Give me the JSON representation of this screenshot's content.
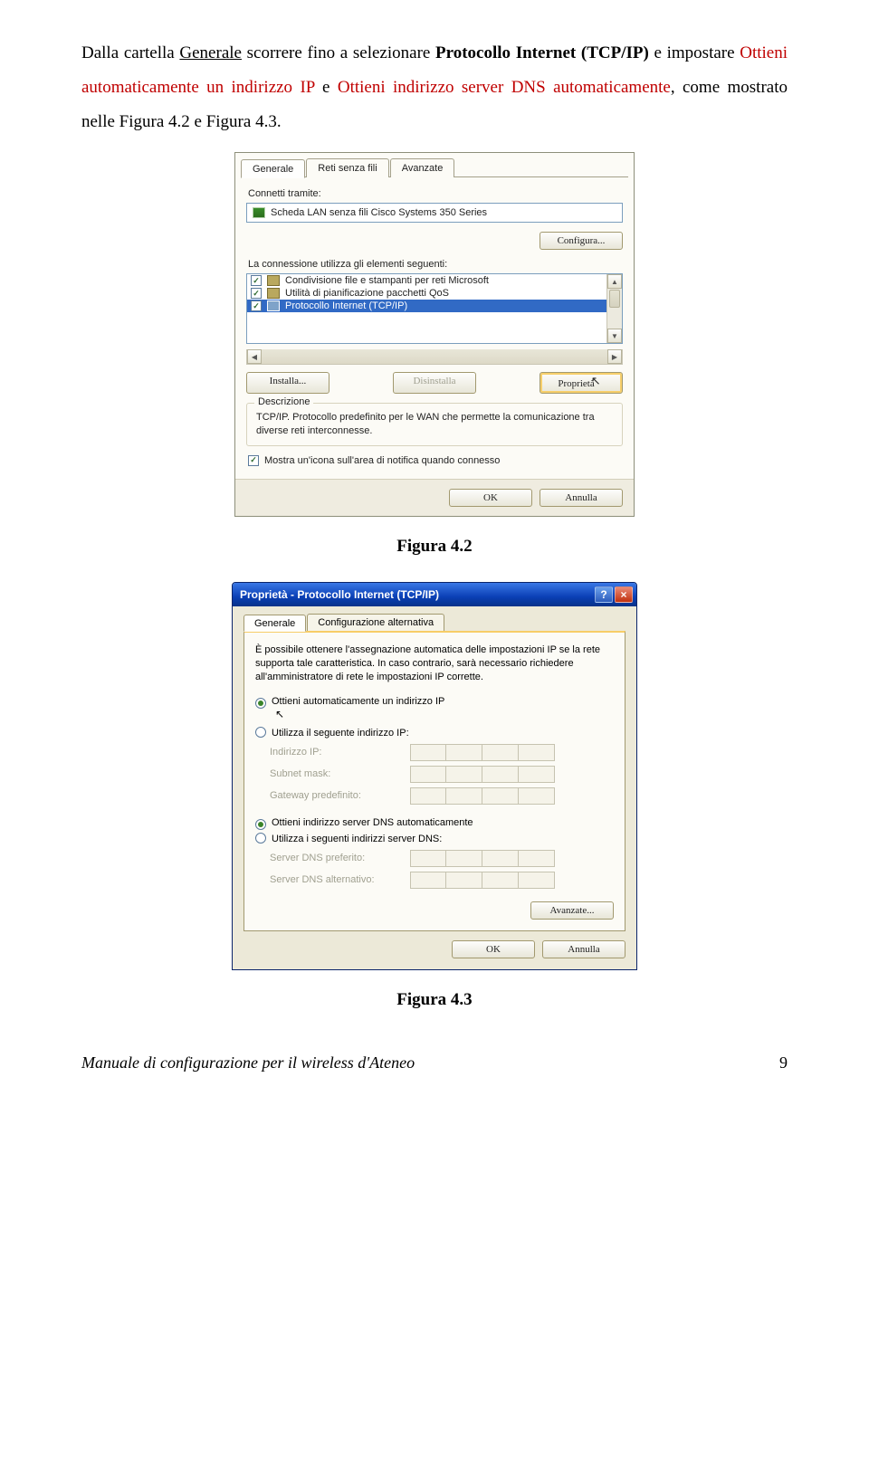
{
  "para": {
    "pre": "Dalla cartella ",
    "generale": "Generale",
    "mid1": " scorrere fino a selezionare ",
    "proto": "Protocollo Internet (TCP/IP)",
    "mid2": " e impostare ",
    "opt1": "Ottieni automaticamente un indirizzo IP",
    "and": " e ",
    "opt2": "Ottieni indirizzo server DNS automaticamente",
    "tail": ", come mostrato nelle Figura 4.2 e Figura 4.3."
  },
  "dlg1": {
    "tabs": [
      "Generale",
      "Reti senza fili",
      "Avanzate"
    ],
    "connetti": "Connetti tramite:",
    "nic": "Scheda LAN senza fili Cisco Systems 350 Series",
    "config": "Configura...",
    "usa": "La connessione utilizza gli elementi seguenti:",
    "items": [
      "Condivisione file e stampanti per reti Microsoft",
      "Utilità di pianificazione pacchetti QoS",
      "Protocollo Internet (TCP/IP)"
    ],
    "btn_inst": "Installa...",
    "btn_dis": "Disinstalla",
    "btn_prop": "Proprietà",
    "desc_cap": "Descrizione",
    "desc": "TCP/IP. Protocollo predefinito per le WAN che permette la comunicazione tra diverse reti interconnesse.",
    "mostra": "Mostra un'icona sull'area di notifica quando connesso",
    "ok": "OK",
    "annulla": "Annulla"
  },
  "figcap1": "Figura 4.2",
  "dlg2": {
    "title": "Proprietà - Protocollo Internet (TCP/IP)",
    "tabs": [
      "Generale",
      "Configurazione alternativa"
    ],
    "intro": "È possibile ottenere l'assegnazione automatica delle impostazioni IP se la rete supporta tale caratteristica. In caso contrario, sarà necessario richiedere all'amministratore di rete le impostazioni IP corrette.",
    "r1": "Ottieni automaticamente un indirizzo IP",
    "r2": "Utilizza il seguente indirizzo IP:",
    "k_ip": "Indirizzo IP:",
    "k_mask": "Subnet mask:",
    "k_gw": "Gateway predefinito:",
    "r3": "Ottieni indirizzo server DNS automaticamente",
    "r4": "Utilizza i seguenti indirizzi server DNS:",
    "k_dns1": "Server DNS preferito:",
    "k_dns2": "Server DNS alternativo:",
    "adv": "Avanzate...",
    "ok": "OK",
    "annulla": "Annulla"
  },
  "figcap2": "Figura 4.3",
  "footer": {
    "title": "Manuale di configurazione per il wireless d'Ateneo",
    "page": "9"
  }
}
